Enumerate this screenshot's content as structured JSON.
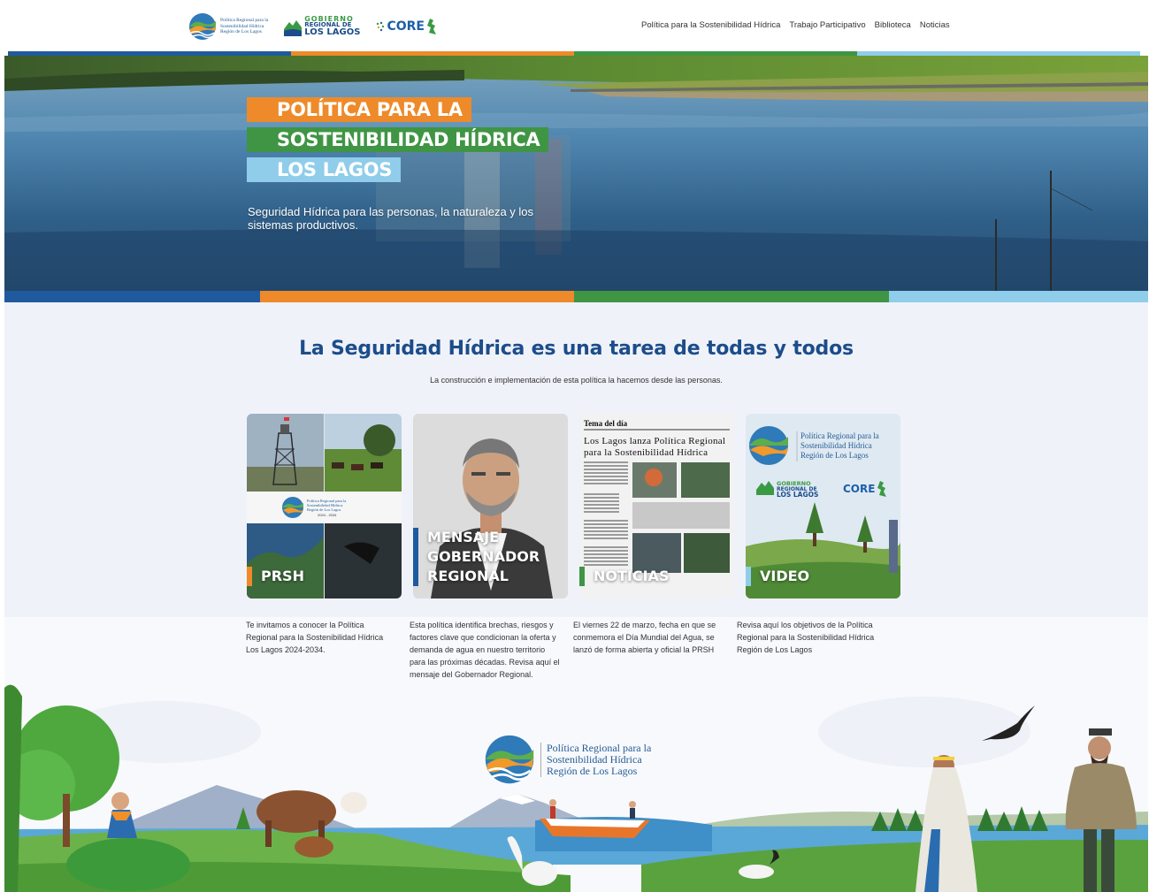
{
  "header": {
    "logo_prsh_text": [
      "Política Regional para la",
      "Sostenibilidad Hídrica",
      "Región de Los Lagos"
    ],
    "logo_gore_text": [
      "GOBIERNO",
      "REGIONAL DE",
      "LOS LAGOS"
    ],
    "logo_core_text": "CORE",
    "nav": [
      {
        "label": "Política para la Sostenibilidad Hídrica"
      },
      {
        "label": "Trabajo Participativo"
      },
      {
        "label": "Biblioteca"
      },
      {
        "label": "Noticias"
      }
    ]
  },
  "colors": {
    "blue_dark": "#1f5a9e",
    "orange": "#ee8a2a",
    "green": "#3f9544",
    "light_blue": "#8fcdea",
    "title_blue": "#1c4d8a"
  },
  "hero": {
    "title_lines": [
      "POLÍTICA PARA LA",
      "SOSTENIBILIDAD HÍDRICA",
      "LOS LAGOS"
    ],
    "subtitle": "Seguridad Hídrica para las personas, la naturaleza y los sistemas productivos."
  },
  "main": {
    "title": "La Seguridad Hídrica es una tarea de todas y todos",
    "subtitle": "La construcción e implementación de esta política la hacemos desde las personas.",
    "cards": [
      {
        "label": "PRSH",
        "icon": "collage-photo",
        "description": "Te invitamos a conocer la Política Regional para la Sostenibilidad Hídrica Los Lagos 2024-2034.",
        "logo_text": [
          "Política Regional para la",
          "Sostenibilidad Hídrica",
          "Región de Los Lagos",
          "2024 - 2034"
        ]
      },
      {
        "label": "MENSAJE GOBERNADOR REGIONAL",
        "icon": "portrait-photo",
        "description": "Esta política identifica brechas, riesgos y factores clave que condicionan la oferta y demanda de agua en nuestro territorio para las próximas décadas. Revisa aquí el mensaje del Gobernador Regional."
      },
      {
        "label": "NOTICIAS",
        "icon": "newspaper-photo",
        "description": "El viernes 22 de marzo, fecha en que se conmemora el Día Mundial del Agua, se lanzó de forma abierta y oficial la PRSH",
        "newspaper_section": "Tema del día",
        "newspaper_headline": "Los Lagos lanza Política Regional para la Sostenibilidad Hídrica"
      },
      {
        "label": "VIDEO",
        "icon": "video-thumbnail",
        "description": "Revisa aquí los objetivos de la Política Regional para la Sostenibilidad Hídrica Región de Los Lagos",
        "logo_text": [
          "Política Regional para la",
          "Sostenibilidad Hídrica",
          "Región de Los Lagos"
        ],
        "gore_text": [
          "GOBIERNO",
          "REGIONAL DE",
          "LOS LAGOS"
        ],
        "core_text": "CORE"
      }
    ]
  },
  "footer": {
    "logo_text": [
      "Política Regional para la",
      "Sostenibilidad Hídrica",
      "Región de Los Lagos"
    ]
  }
}
